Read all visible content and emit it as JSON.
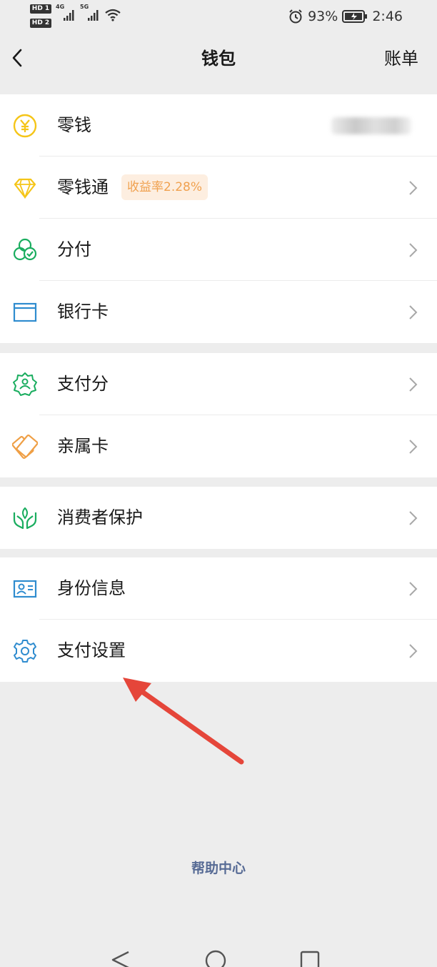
{
  "status_bar": {
    "hd1": "HD 1",
    "hd2": "HD 2",
    "sim1": "4G",
    "sim2": "5G",
    "battery_percent": "93%",
    "time": "2:46"
  },
  "nav": {
    "title": "钱包",
    "right": "账单"
  },
  "groups": [
    {
      "items": [
        {
          "label": "零钱",
          "icon": "yuan-coin-icon"
        },
        {
          "label": "零钱通",
          "icon": "diamond-icon",
          "badge": "收益率2.28%"
        },
        {
          "label": "分付",
          "icon": "fenfu-icon"
        },
        {
          "label": "银行卡",
          "icon": "bank-card-icon"
        }
      ]
    },
    {
      "items": [
        {
          "label": "支付分",
          "icon": "score-badge-icon"
        },
        {
          "label": "亲属卡",
          "icon": "family-card-icon"
        }
      ]
    },
    {
      "items": [
        {
          "label": "消费者保护",
          "icon": "protect-hands-icon"
        }
      ]
    },
    {
      "items": [
        {
          "label": "身份信息",
          "icon": "id-card-icon"
        },
        {
          "label": "支付设置",
          "icon": "gear-icon"
        }
      ]
    }
  ],
  "help": "帮助中心",
  "colors": {
    "link": "#576b95",
    "badge_text": "#f0a14f",
    "badge_bg": "#fdeee0",
    "arrow": "#e5463a",
    "green": "#1aad5f",
    "blue": "#2f8ccf"
  }
}
